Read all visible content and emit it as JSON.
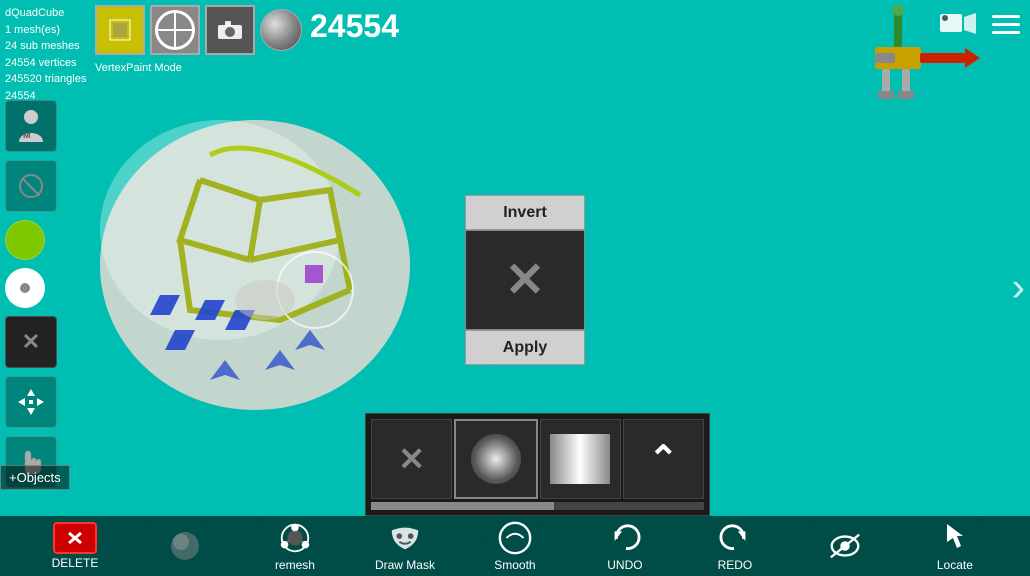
{
  "app": {
    "title": "dQuadCube",
    "mesh_info": {
      "meshes": "1 mesh(es)",
      "sub_meshes": "24 sub meshes",
      "vertices": "24554 vertices",
      "triangles": "245520 triangles",
      "id": "24554"
    },
    "vertex_count": "24554",
    "mode_label": "VertexPaint  Mode"
  },
  "toolbar": {
    "invert_label": "Invert",
    "apply_label": "Apply"
  },
  "bottom_toolbar": {
    "remesh_label": "remesh",
    "draw_mask_label": "Draw Mask",
    "smooth_label": "Smooth",
    "undo_label": "UNDO",
    "redo_label": "REDO",
    "locate_label": "Locate",
    "delete_label": "DELETE",
    "objects_label": "+Objects"
  },
  "brush_progress": 55,
  "colors": {
    "teal_bg": "#00bfb2",
    "popup_btn": "#d0d0d0",
    "dark_panel": "#1a1a1a"
  }
}
